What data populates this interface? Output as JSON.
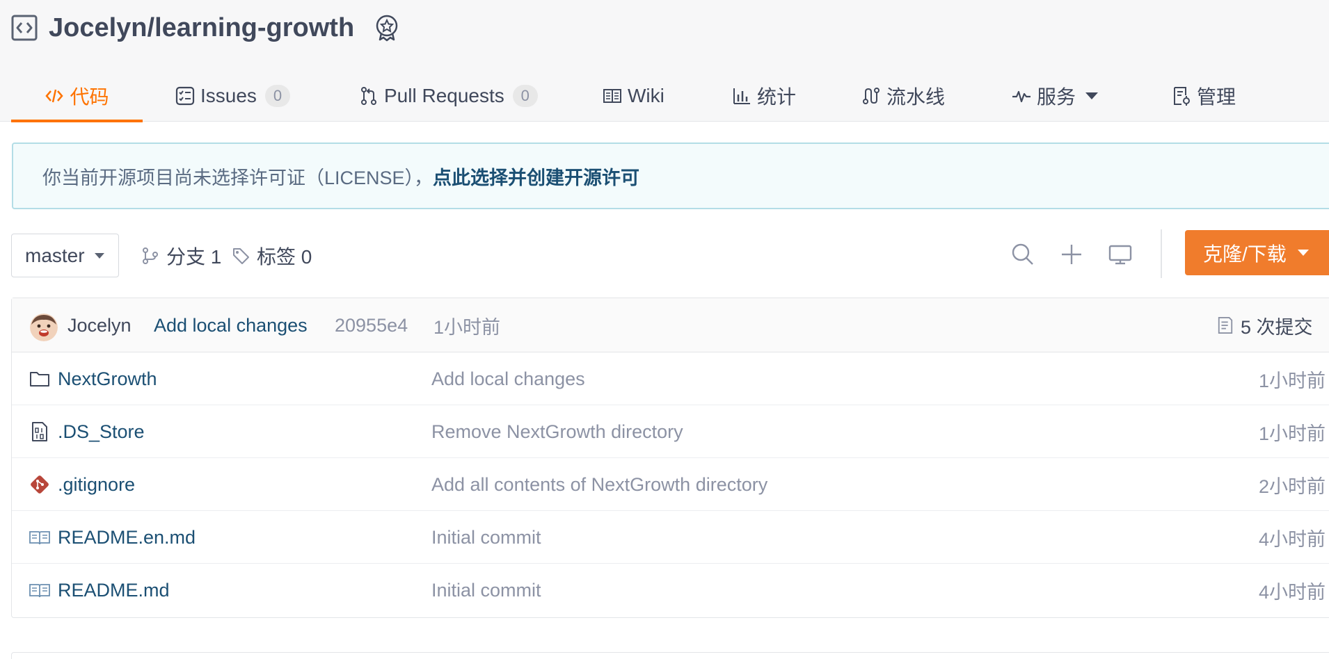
{
  "repo": {
    "name": "Jocelyn/learning-growth",
    "repo_icon": "code-repo-icon",
    "badge_icon": "recommend-badge-icon"
  },
  "tabs": [
    {
      "label": "代码",
      "icon": "code-icon",
      "active": true
    },
    {
      "label": "Issues",
      "icon": "issues-icon",
      "count": "0"
    },
    {
      "label": "Pull Requests",
      "icon": "pull-request-icon",
      "count": "0"
    },
    {
      "label": "Wiki",
      "icon": "wiki-book-icon"
    },
    {
      "label": "统计",
      "icon": "bar-chart-icon"
    },
    {
      "label": "流水线",
      "icon": "pipeline-icon"
    },
    {
      "label": "服务",
      "icon": "pulse-icon",
      "dropdown": true
    },
    {
      "label": "管理",
      "icon": "settings-doc-icon"
    }
  ],
  "license_banner": {
    "text": "你当前开源项目尚未选择许可证（LICENSE），",
    "link": "点此选择并创建开源许可"
  },
  "branch": {
    "selected": "master",
    "branches_label": "分支 1",
    "tags_label": "标签 0"
  },
  "toolbar": {
    "search_icon": "search-icon",
    "add_icon": "plus-icon",
    "web_ide_icon": "monitor-icon",
    "clone_label": "克隆/下载"
  },
  "latest_commit": {
    "author": "Jocelyn",
    "message": "Add local changes",
    "hash": "20955e4",
    "time": "1小时前",
    "commit_count": "5 次提交"
  },
  "files": [
    {
      "name": "NextGrowth",
      "icon": "folder-icon",
      "message": "Add local changes",
      "time": "1小时前"
    },
    {
      "name": ".DS_Store",
      "icon": "binary-file-icon",
      "message": "Remove NextGrowth directory",
      "time": "1小时前"
    },
    {
      "name": ".gitignore",
      "icon": "git-icon",
      "message": "Add all contents of NextGrowth directory",
      "time": "2小时前"
    },
    {
      "name": "README.en.md",
      "icon": "readme-book-icon",
      "message": "Initial commit",
      "time": "4小时前"
    },
    {
      "name": "README.md",
      "icon": "readme-book-icon",
      "message": "Initial commit",
      "time": "4小时前"
    }
  ],
  "colors": {
    "accent": "#fe7300",
    "clone_button": "#f07c2c",
    "link": "#1b4f73",
    "banner_bg": "#f3fbfc",
    "banner_border": "#b3dde6"
  }
}
